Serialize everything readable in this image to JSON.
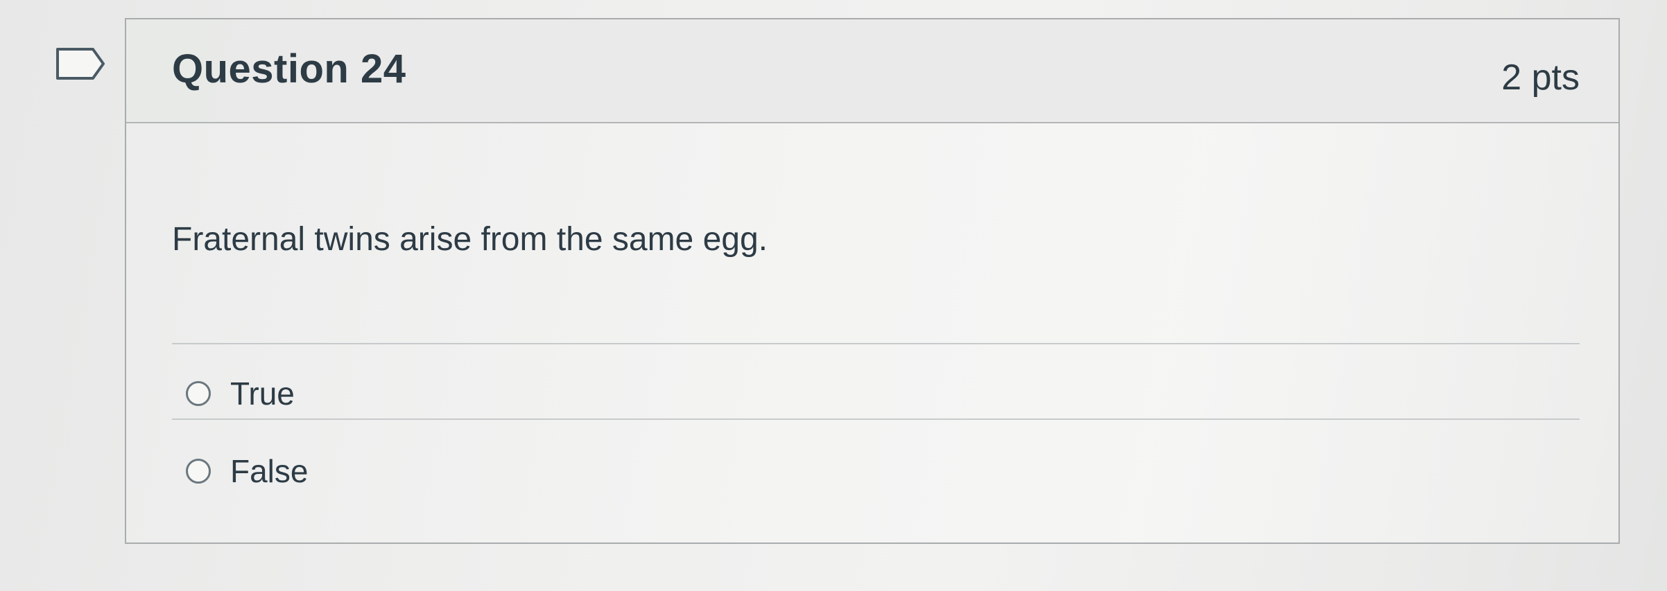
{
  "question": {
    "title": "Question 24",
    "points": "2 pts",
    "text": "Fraternal twins arise from the same egg.",
    "flag_icon": "bookmark-flag-icon",
    "answers": [
      {
        "label": "True",
        "selected": false
      },
      {
        "label": "False",
        "selected": false
      }
    ]
  },
  "colors": {
    "text": "#2d3b45",
    "border": "#a9acad",
    "header_bg": "#e8e9e8"
  }
}
